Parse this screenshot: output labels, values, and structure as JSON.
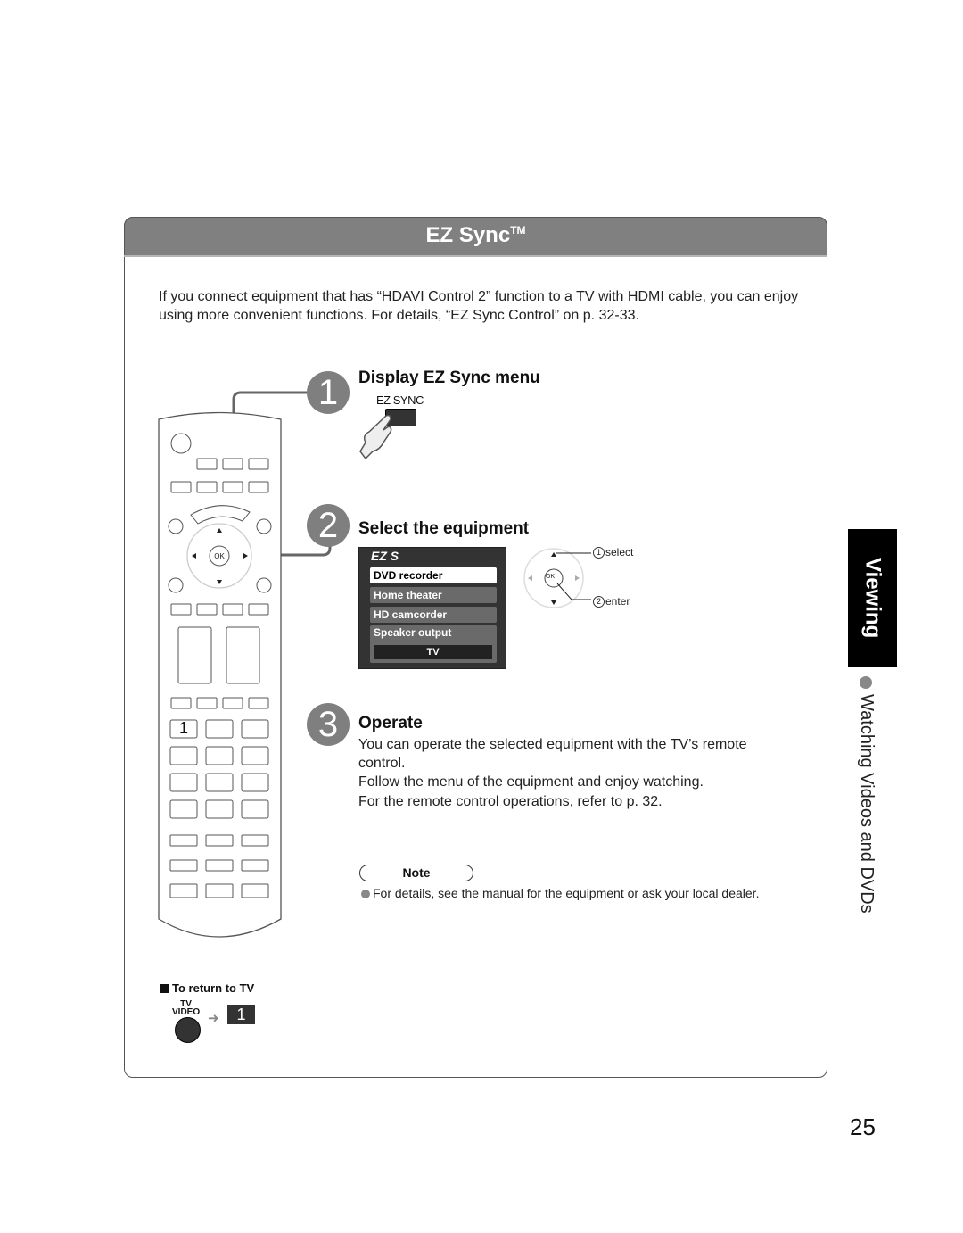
{
  "header": {
    "title": "EZ Sync",
    "title_mark": "TM"
  },
  "intro": "If you connect equipment that has “HDAVI Control 2” function to a TV with HDMI cable, you can enjoy using more convenient functions. For details, “EZ Sync Control” on p. 32-33.",
  "steps": [
    {
      "number": "1",
      "title": "Display EZ Sync menu",
      "button_label": "EZ SYNC"
    },
    {
      "number": "2",
      "title": "Select the equipment",
      "menu": {
        "logo": "EZ S",
        "items": [
          "DVD recorder",
          "Home theater",
          "HD camcorder"
        ],
        "selected": "DVD recorder",
        "speaker_label": "Speaker output",
        "speaker_value": "TV"
      },
      "nav": {
        "ok_label": "OK",
        "select_num": "1",
        "select_label": "select",
        "enter_num": "2",
        "enter_label": "enter"
      }
    },
    {
      "number": "3",
      "title": "Operate",
      "lines": [
        "You can operate the selected equipment with the TV’s remote control.",
        "Follow the menu of the equipment and enjoy watching.",
        "For the remote control operations, refer to p. 32."
      ]
    }
  ],
  "note": {
    "label": "Note",
    "text": "For details, see the manual for the equipment or ask your local dealer."
  },
  "remote": {
    "ok_label": "OK",
    "key_1": "1"
  },
  "return_to_tv": {
    "label": "To return to TV",
    "tv_label": "TV",
    "video_label": "VIDEO",
    "key": "1"
  },
  "side": {
    "tab": "Viewing",
    "subtitle": "Watching Videos and DVDs"
  },
  "page_number": "25"
}
